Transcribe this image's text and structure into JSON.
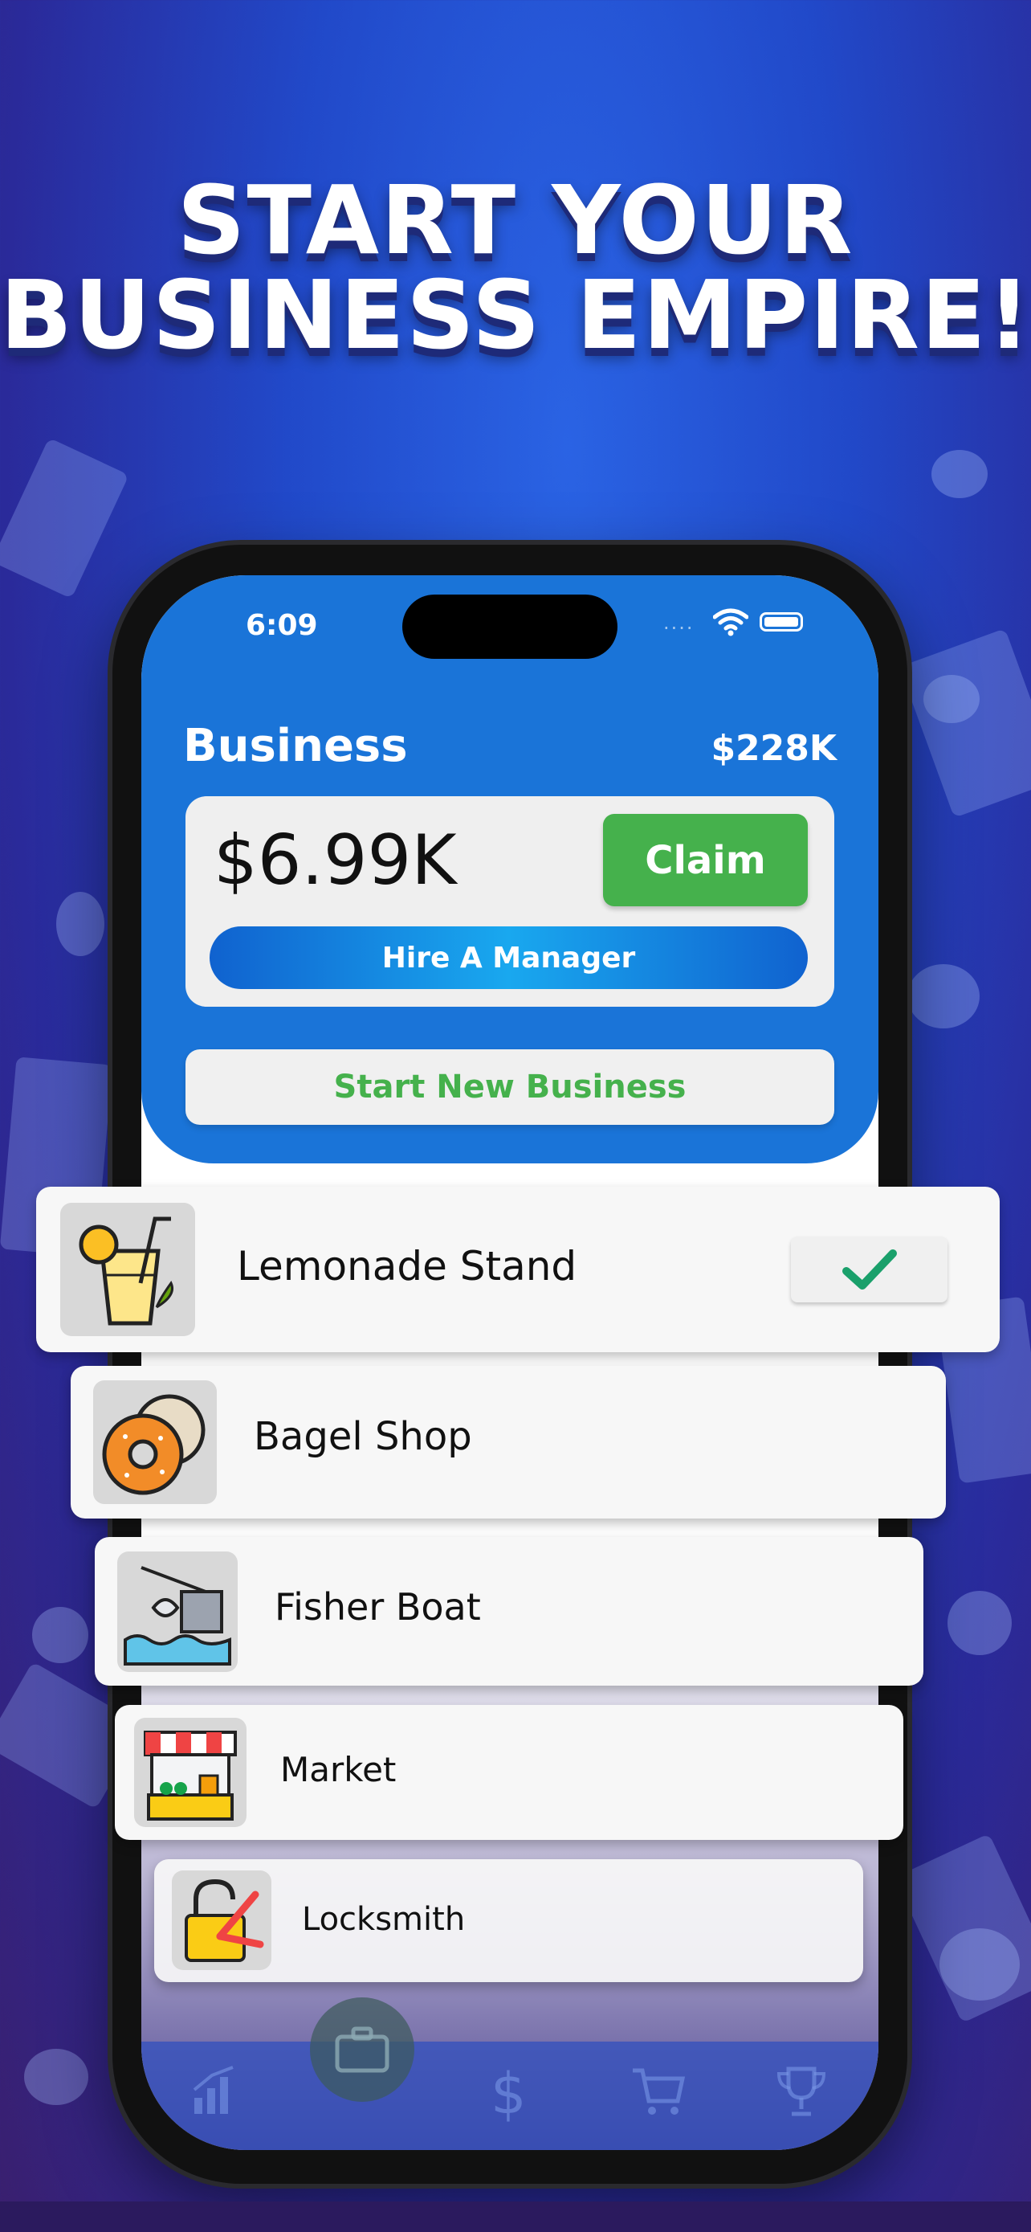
{
  "headline": {
    "line1": "START YOUR",
    "line2": "BUSINESS EMPIRE!"
  },
  "status_bar": {
    "time": "6:09",
    "signal": "····"
  },
  "header": {
    "title": "Business",
    "total": "$228K"
  },
  "earnings_card": {
    "amount": "$6.99K",
    "claim_label": "Claim",
    "hire_label": "Hire A Manager"
  },
  "start_button": {
    "label": "Start New Business"
  },
  "businesses": [
    {
      "name": "Lemonade Stand",
      "icon": "lemonade-icon",
      "selected": true
    },
    {
      "name": "Bagel Shop",
      "icon": "bagel-icon"
    },
    {
      "name": "Fisher Boat",
      "icon": "fishing-boat-icon"
    },
    {
      "name": "Market",
      "icon": "market-stall-icon"
    },
    {
      "name": "Locksmith",
      "icon": "lock-icon"
    }
  ],
  "tabs": [
    "chart-icon",
    "briefcase-icon",
    "dollar-icon",
    "cart-icon",
    "trophy-icon"
  ],
  "colors": {
    "accent_green": "#45b14c",
    "header_blue": "#1a74d8",
    "hire_blue": "#19a8ef"
  }
}
